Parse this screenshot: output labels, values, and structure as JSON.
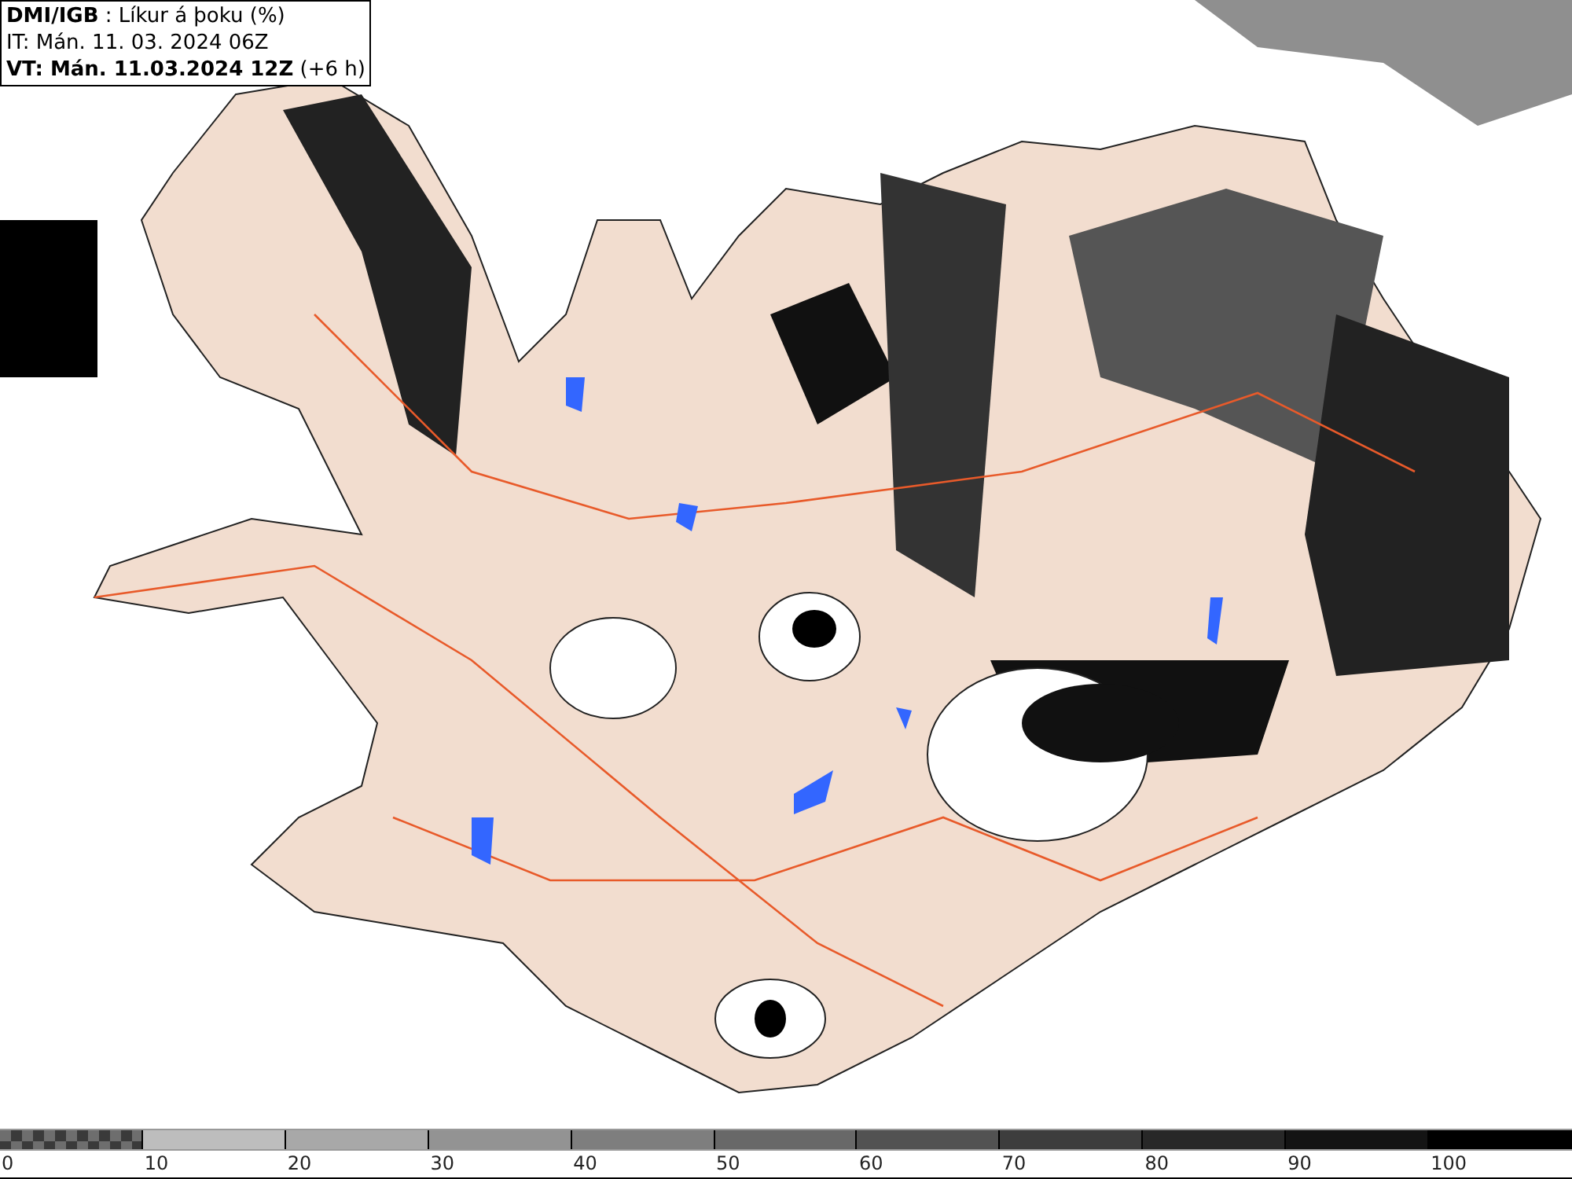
{
  "info_box": {
    "lines": [
      "**DMI/IGB** : Líkur á þoku (%)",
      "IT: Mán. 11. 03. 2024 06Z",
      "**VT: Mán. 11.03.2024 12Z** (+6 h)"
    ]
  },
  "legend": [
    {
      "kind": "checker",
      "label": "0",
      "color": "#6e6e6e"
    },
    {
      "kind": "solid",
      "label": "10",
      "color": "#bdbdbd"
    },
    {
      "kind": "solid",
      "label": "20",
      "color": "#a8a8a8"
    },
    {
      "kind": "solid",
      "label": "30",
      "color": "#939393"
    },
    {
      "kind": "solid",
      "label": "40",
      "color": "#7e7e7e"
    },
    {
      "kind": "solid",
      "label": "50",
      "color": "#686868"
    },
    {
      "kind": "solid",
      "label": "60",
      "color": "#525252"
    },
    {
      "kind": "solid",
      "label": "70",
      "color": "#3d3d3d"
    },
    {
      "kind": "solid",
      "label": "80",
      "color": "#282828"
    },
    {
      "kind": "solid",
      "label": "90",
      "color": "#141414"
    },
    {
      "kind": "solid",
      "label": "100",
      "color": "#000000"
    }
  ]
}
